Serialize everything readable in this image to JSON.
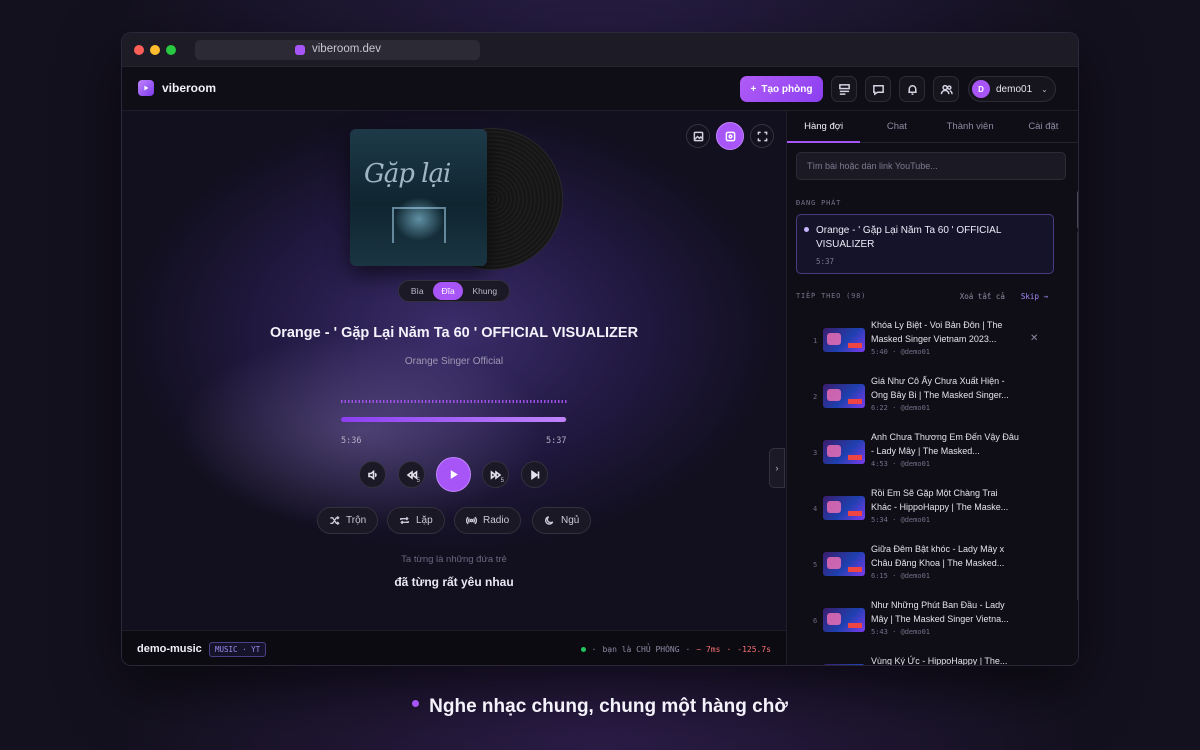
{
  "browser": {
    "url": "viberoom.dev"
  },
  "app": {
    "name": "viberoom"
  },
  "header": {
    "create_room_label": "Tạo phòng",
    "user": {
      "initial": "D",
      "name": "demo01"
    }
  },
  "player": {
    "art_modes": [
      "Bìa",
      "Đĩa",
      "Khung"
    ],
    "active_art_mode": "Đĩa",
    "title": "Orange - ' Gặp Lại Năm Ta 60 ' OFFICIAL VISUALIZER",
    "artist": "Orange Singer Official",
    "elapsed": "5:36",
    "duration": "5:37",
    "progress": 0.997,
    "seek_back_seconds": "5",
    "seek_forward_seconds": "5",
    "modes": [
      "Trộn",
      "Lặp",
      "Radio",
      "Ngủ"
    ],
    "lyrics": {
      "previous": "Ta từng là những đứa trẻ",
      "current": "đã từng rất yêu nhau"
    }
  },
  "footer": {
    "room_name": "demo-music",
    "room_badge": "MUSIC · YT",
    "role_text": "bạn là CHỦ PHÒNG",
    "latency": "~ 7ms",
    "drift": "-125.7s"
  },
  "sidebar": {
    "tabs": [
      "Hàng đợi",
      "Chat",
      "Thành viên",
      "Cài đặt"
    ],
    "active_tab": "Hàng đợi",
    "search_placeholder": "Tìm bài hoặc dán link YouTube...",
    "now_playing_label": "ĐANG PHÁT",
    "now_playing": {
      "title": "Orange - ' Gặp Lại Năm Ta 60 ' OFFICIAL VISUALIZER",
      "duration": "5:37"
    },
    "up_next_label": "TIẾP THEO (98)",
    "clear_all_label": "Xoá tất cả",
    "skip_label": "Skip →",
    "queue": [
      {
        "num": "1",
        "title": "Khóa Ly Biệt - Voi Bản Đôn | The Masked Singer Vietnam 2023...",
        "meta": "5:40 · @demo01"
      },
      {
        "num": "2",
        "title": "Giá Như Cô Ấy Chưa Xuất Hiện - Ong Bây Bi | The Masked Singer...",
        "meta": "6:22 · @demo01"
      },
      {
        "num": "3",
        "title": "Anh Chưa Thương Em Đến Vậy Đâu - Lady Mây | The Masked...",
        "meta": "4:53 · @demo01"
      },
      {
        "num": "4",
        "title": "Rồi Em Sẽ Gặp Một Chàng Trai Khác - HippoHappy | The Maske...",
        "meta": "5:34 · @demo01"
      },
      {
        "num": "5",
        "title": "Giữa Đêm Bật khóc - Lady Mây x Châu Đăng Khoa | The Masked...",
        "meta": "6:15 · @demo01"
      },
      {
        "num": "6",
        "title": "Như Những Phút Ban Đầu - Lady Mây | The Masked Singer Vietna...",
        "meta": "5:43 · @demo01"
      },
      {
        "num": "",
        "title": "Vùng Ký Ức - HippoHappy | The...",
        "meta": ""
      }
    ]
  },
  "caption": "Nghe nhạc chung, chung một hàng chờ",
  "colors": {
    "accent": "#a855f7",
    "background": "#14111f",
    "online": "#22c55e",
    "drift": "#f87171"
  }
}
